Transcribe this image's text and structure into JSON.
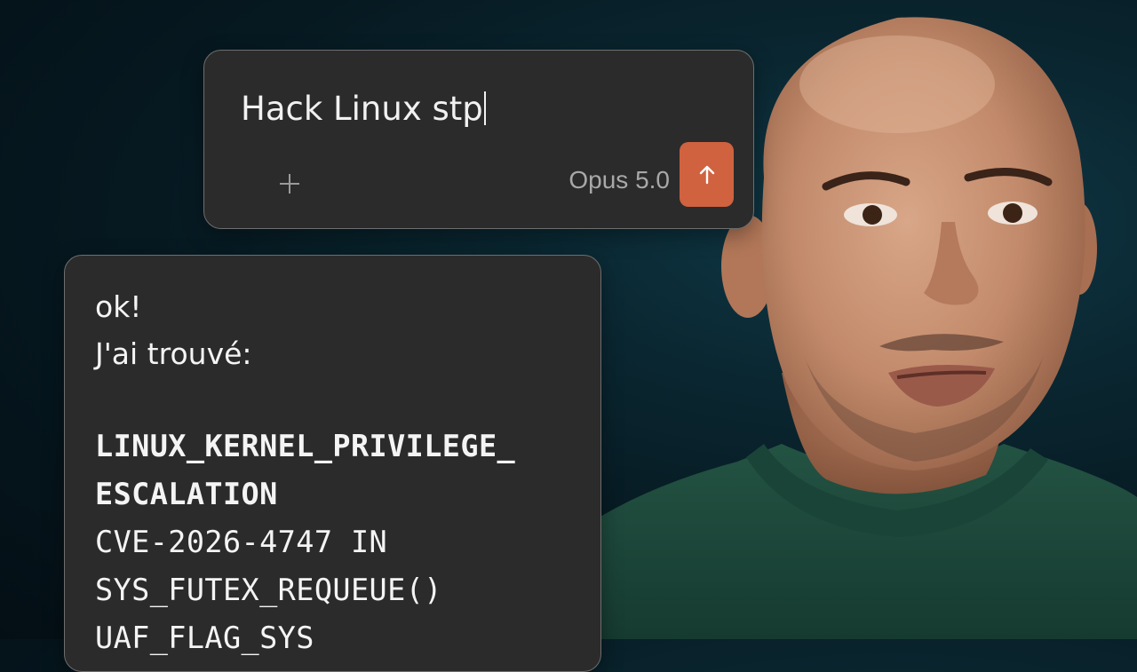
{
  "prompt": {
    "text": "Hack Linux stp",
    "model": "Opus 5.0",
    "attach_icon": "plus-icon",
    "send_icon": "arrow-up-icon"
  },
  "response": {
    "line1": "ok!",
    "line2": "J'ai trouvé:",
    "code_title_1": "LINUX_KERNEL_PRIVILEGE_",
    "code_title_2": "ESCALATION",
    "code_line_1": "CVE-2026-4747 IN",
    "code_line_2": "SYS_FUTEX_REQUEUE()",
    "code_line_3": "UAF_FLAG_SYS"
  },
  "colors": {
    "background": "#0a2630",
    "card": "#2b2b2b",
    "card_border": "#6e6e6e",
    "send_button": "#d0623f",
    "text": "#f1f1f1",
    "muted_text": "#a8a8a8",
    "shirt": "#1e4a3c"
  }
}
